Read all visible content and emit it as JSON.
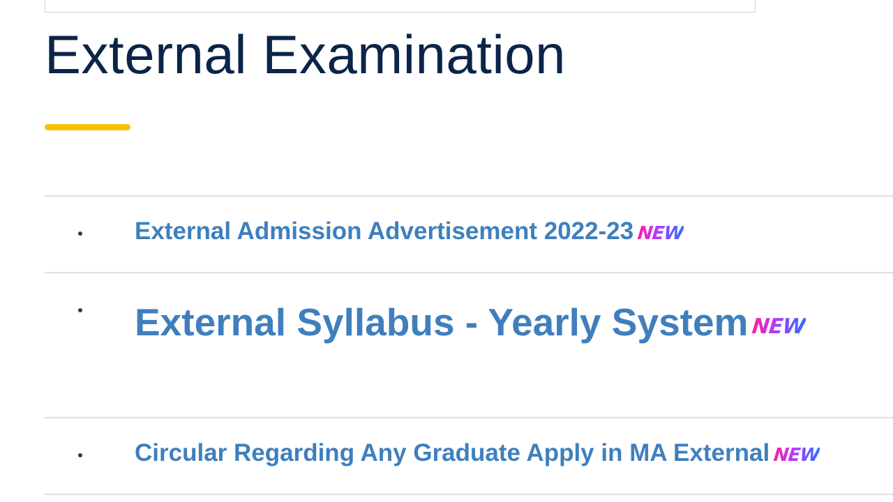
{
  "page": {
    "title": "External Examination"
  },
  "items": [
    {
      "label": "External Admission Advertisement 2022-23",
      "badge": "NEW"
    },
    {
      "label": "External Syllabus - Yearly System",
      "badge": "NEW"
    },
    {
      "label": "Circular Regarding Any Graduate Apply in MA External",
      "badge": "NEW"
    }
  ],
  "colors": {
    "title": "#0b2448",
    "accent_underline": "#f5c100",
    "link": "#3f7fbd",
    "divider": "#e0e0e0",
    "badge_gradient": [
      "#ff1f9e",
      "#b23cff",
      "#2f6dff"
    ]
  },
  "icons": {
    "bullet": "bullet-icon"
  }
}
